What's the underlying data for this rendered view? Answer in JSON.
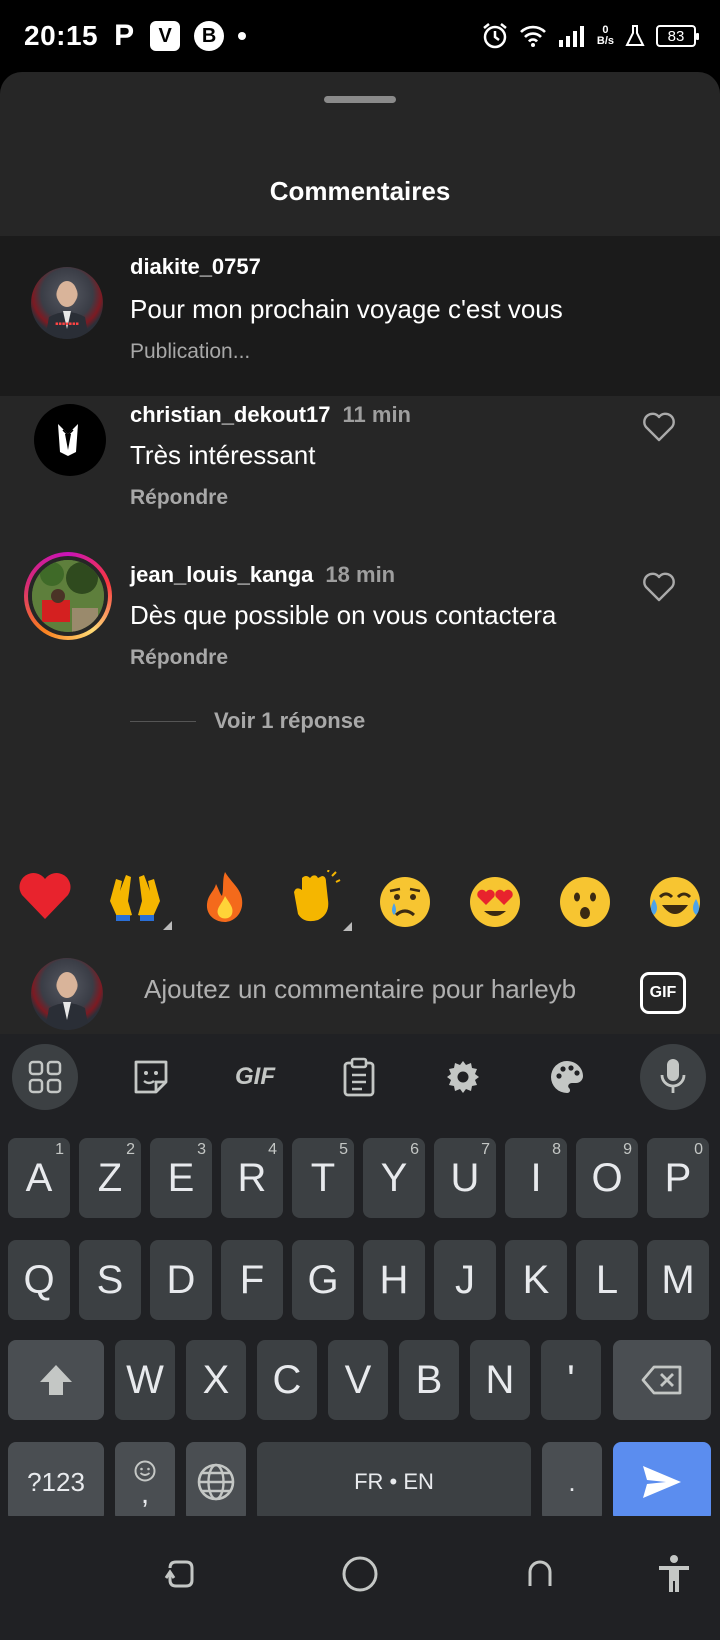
{
  "status_bar": {
    "time": "20:15",
    "apps": [
      "P",
      "V",
      "B"
    ],
    "net_speed_value": "0",
    "net_speed_unit": "B/s",
    "battery": "83"
  },
  "sheet": {
    "title": "Commentaires"
  },
  "caption": {
    "username": "diakite_0757",
    "text": "Pour mon  prochain voyage c'est vous",
    "subtext": "Publication..."
  },
  "comments": [
    {
      "username": "christian_dekout17",
      "time": "11 min",
      "text": "Très intéressant",
      "reply_label": "Répondre"
    },
    {
      "username": "jean_louis_kanga",
      "time": "18 min",
      "text": "Dès que possible on vous contactera",
      "reply_label": "Répondre"
    }
  ],
  "view_replies": "Voir 1 réponse",
  "emoji_bar": [
    "heart",
    "raised-hands",
    "fire",
    "clapping-hands",
    "crying-face",
    "heart-eyes",
    "surprised-face",
    "tears-of-joy"
  ],
  "comment_input": {
    "placeholder": "Ajoutez un commentaire pour harleyb",
    "gif_label": "GIF"
  },
  "keyboard": {
    "toolbar_gif": "GIF",
    "row1": [
      {
        "k": "A",
        "h": "1"
      },
      {
        "k": "Z",
        "h": "2"
      },
      {
        "k": "E",
        "h": "3"
      },
      {
        "k": "R",
        "h": "4"
      },
      {
        "k": "T",
        "h": "5"
      },
      {
        "k": "Y",
        "h": "6"
      },
      {
        "k": "U",
        "h": "7"
      },
      {
        "k": "I",
        "h": "8"
      },
      {
        "k": "O",
        "h": "9"
      },
      {
        "k": "P",
        "h": "0"
      }
    ],
    "row2": [
      "Q",
      "S",
      "D",
      "F",
      "G",
      "H",
      "J",
      "K",
      "L",
      "M"
    ],
    "row3": [
      "W",
      "X",
      "C",
      "V",
      "B",
      "N",
      "'"
    ],
    "symbols_key": "?123",
    "comma_key": ",",
    "space_label": "FR • EN",
    "period_key": "."
  },
  "colors": {
    "sheet_bg": "#262626",
    "caption_bg": "#1b1b1b",
    "keyboard_bg": "#202124",
    "key_bg": "#3c4043",
    "send_key": "#5b8def"
  }
}
